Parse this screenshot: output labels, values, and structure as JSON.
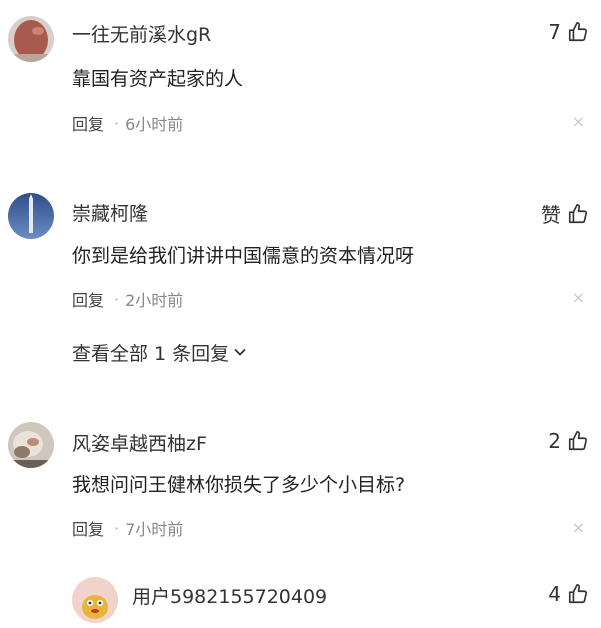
{
  "comments": [
    {
      "username": "一往无前溪水gR",
      "likes": "7",
      "text": "靠国有资产起家的人",
      "reply_label": "回复",
      "separator": "·",
      "time": "6小时前",
      "close_glyph": "×"
    },
    {
      "username": "崇藏柯隆",
      "likes": "赞",
      "text": "你到是给我们讲讲中国儒意的资本情况呀",
      "reply_label": "回复",
      "separator": "·",
      "time": "2小时前",
      "close_glyph": "×",
      "expand_label": "查看全部 1 条回复"
    },
    {
      "username": "风姿卓越西柚zF",
      "likes": "2",
      "text": "我想问问王健林你损失了多少个小目标?",
      "reply_label": "回复",
      "separator": "·",
      "time": "7小时前",
      "close_glyph": "×"
    },
    {
      "username": "用户5982155720409",
      "likes": "4"
    }
  ],
  "icons": {
    "like": "thumbs-up-icon",
    "expand": "chevron-down-icon",
    "close": "close-icon"
  }
}
